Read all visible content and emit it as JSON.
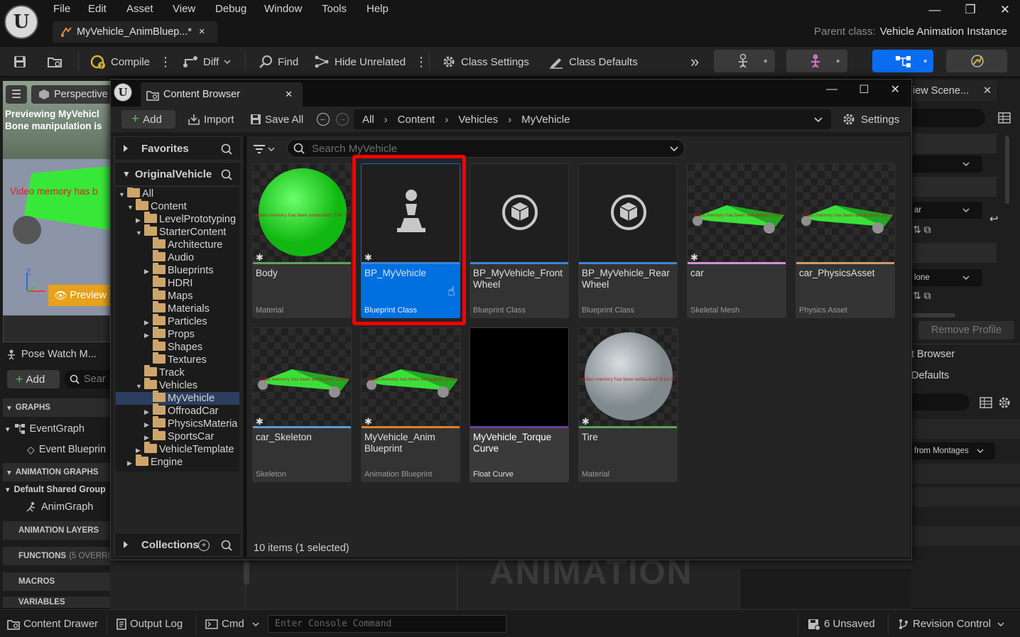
{
  "menu": {
    "file": "File",
    "edit": "Edit",
    "asset": "Asset",
    "view": "View",
    "debug": "Debug",
    "window": "Window",
    "tools": "Tools",
    "help": "Help"
  },
  "tab": {
    "title": "MyVehicle_AnimBluep...*",
    "close": "×"
  },
  "parent": {
    "label": "Parent class:",
    "value": "Vehicle Animation Instance"
  },
  "toolbar": {
    "compile": "Compile",
    "diff": "Diff",
    "find": "Find",
    "hide_unrelated": "Hide Unrelated",
    "class_settings": "Class Settings",
    "class_defaults": "Class Defaults",
    "more": "»"
  },
  "viewport": {
    "menu_icon": "hamburger-icon",
    "perspective": "Perspective",
    "msg1": "Previewing MyVehicl",
    "msg2": "Bone manipulation is",
    "video_memory": "Video memory has b",
    "preview": "Preview",
    "axis_z": "Z"
  },
  "left_panel": {
    "pose_watch": "Pose Watch M...",
    "add": "Add",
    "search": "Sear",
    "graphs": "GRAPHS",
    "event_graph": "EventGraph",
    "event_blueprint": "Event Blueprin",
    "anim_graphs": "ANIMATION GRAPHS",
    "default_group": "Default Shared Group",
    "anim_graph": "AnimGraph",
    "anim_layers": "ANIMATION LAYERS",
    "functions": "FUNCTIONS",
    "functions_note": "(5 OVERRID",
    "macros": "MACROS",
    "variables": "VARIABLES"
  },
  "content_browser": {
    "title": "Content Browser",
    "add": "Add",
    "import": "Import",
    "save_all": "Save All",
    "path": [
      "All",
      "Content",
      "Vehicles",
      "MyVehicle"
    ],
    "settings": "Settings",
    "search_placeholder": "Search MyVehicle",
    "favorites": "Favorites",
    "root": "OriginalVehicle",
    "collections": "Collections",
    "tree": [
      {
        "label": "All",
        "indent": 0,
        "expand": "open"
      },
      {
        "label": "Content",
        "indent": 1,
        "expand": "open"
      },
      {
        "label": "LevelPrototyping",
        "indent": 2,
        "expand": "closed"
      },
      {
        "label": "StarterContent",
        "indent": 2,
        "expand": "open"
      },
      {
        "label": "Architecture",
        "indent": 3,
        "expand": "none"
      },
      {
        "label": "Audio",
        "indent": 3,
        "expand": "none"
      },
      {
        "label": "Blueprints",
        "indent": 3,
        "expand": "closed"
      },
      {
        "label": "HDRI",
        "indent": 3,
        "expand": "none"
      },
      {
        "label": "Maps",
        "indent": 3,
        "expand": "none"
      },
      {
        "label": "Materials",
        "indent": 3,
        "expand": "none"
      },
      {
        "label": "Particles",
        "indent": 3,
        "expand": "closed"
      },
      {
        "label": "Props",
        "indent": 3,
        "expand": "closed"
      },
      {
        "label": "Shapes",
        "indent": 3,
        "expand": "none"
      },
      {
        "label": "Textures",
        "indent": 3,
        "expand": "none"
      },
      {
        "label": "Track",
        "indent": 2,
        "expand": "none"
      },
      {
        "label": "Vehicles",
        "indent": 2,
        "expand": "open"
      },
      {
        "label": "MyVehicle",
        "indent": 3,
        "expand": "none",
        "selected": true
      },
      {
        "label": "OffroadCar",
        "indent": 3,
        "expand": "closed"
      },
      {
        "label": "PhysicsMateria",
        "indent": 3,
        "expand": "closed"
      },
      {
        "label": "SportsCar",
        "indent": 3,
        "expand": "closed"
      },
      {
        "label": "VehicleTemplate",
        "indent": 2,
        "expand": "closed"
      },
      {
        "label": "Engine",
        "indent": 1,
        "expand": "closed"
      }
    ],
    "assets": [
      {
        "name": "Body",
        "type": "Material",
        "bar": "#5ea35e",
        "thumb": "green-sphere",
        "star": true
      },
      {
        "name": "BP_MyVehicle",
        "type": "Blueprint Class",
        "bar": "#3a86d4",
        "thumb": "pawn",
        "star": true,
        "selected": true
      },
      {
        "name": "BP_MyVehicle_Front Wheel",
        "type": "Blueprint Class",
        "bar": "#3a86d4",
        "thumb": "cube",
        "star": false
      },
      {
        "name": "BP_MyVehicle_Rear Wheel",
        "type": "Blueprint Class",
        "bar": "#3a86d4",
        "thumb": "cube",
        "star": false
      },
      {
        "name": "car",
        "type": "Skeletal Mesh",
        "bar": "#d88fd8",
        "thumb": "car-mesh",
        "star": true
      },
      {
        "name": "car_PhysicsAsset",
        "type": "Physics Asset",
        "bar": "#d09a6a",
        "thumb": "car-mesh",
        "star": false
      },
      {
        "name": "car_Skeleton",
        "type": "Skeleton",
        "bar": "#5b9bd5",
        "thumb": "car-mesh",
        "star": true
      },
      {
        "name": "MyVehicle_Anim Blueprint",
        "type": "Animation Blueprint",
        "bar": "#e0802a",
        "thumb": "car-mesh",
        "star": true
      },
      {
        "name": "MyVehicle_Torque Curve",
        "type": "Float Curve",
        "bar": "#6b3fa0",
        "thumb": "black",
        "star": false
      },
      {
        "name": "Tire",
        "type": "Material",
        "bar": "#5ea35e",
        "thumb": "grey-sphere",
        "star": true
      }
    ],
    "video_memory": "Video memory has been exhausted",
    "status": "10 items (1 selected)"
  },
  "right_panel": {
    "tab": "iew Scene...",
    "dropdown1": "ar",
    "dropdown2": "lone",
    "remove_profile": "Remove Profile",
    "browser": "t Browser",
    "defaults": "Defaults",
    "from_montages": "from Montages"
  },
  "bottom": {
    "content_drawer": "Content Drawer",
    "output_log": "Output Log",
    "cmd": "Cmd",
    "console_placeholder": "Enter Console Command",
    "unsaved": "6 Unsaved",
    "revision_control": "Revision Control"
  },
  "watermark": "ANIMATION",
  "colors": {
    "selection": "#0070e0",
    "highlight": "#ff0000",
    "accent": "#0a6cf0"
  }
}
